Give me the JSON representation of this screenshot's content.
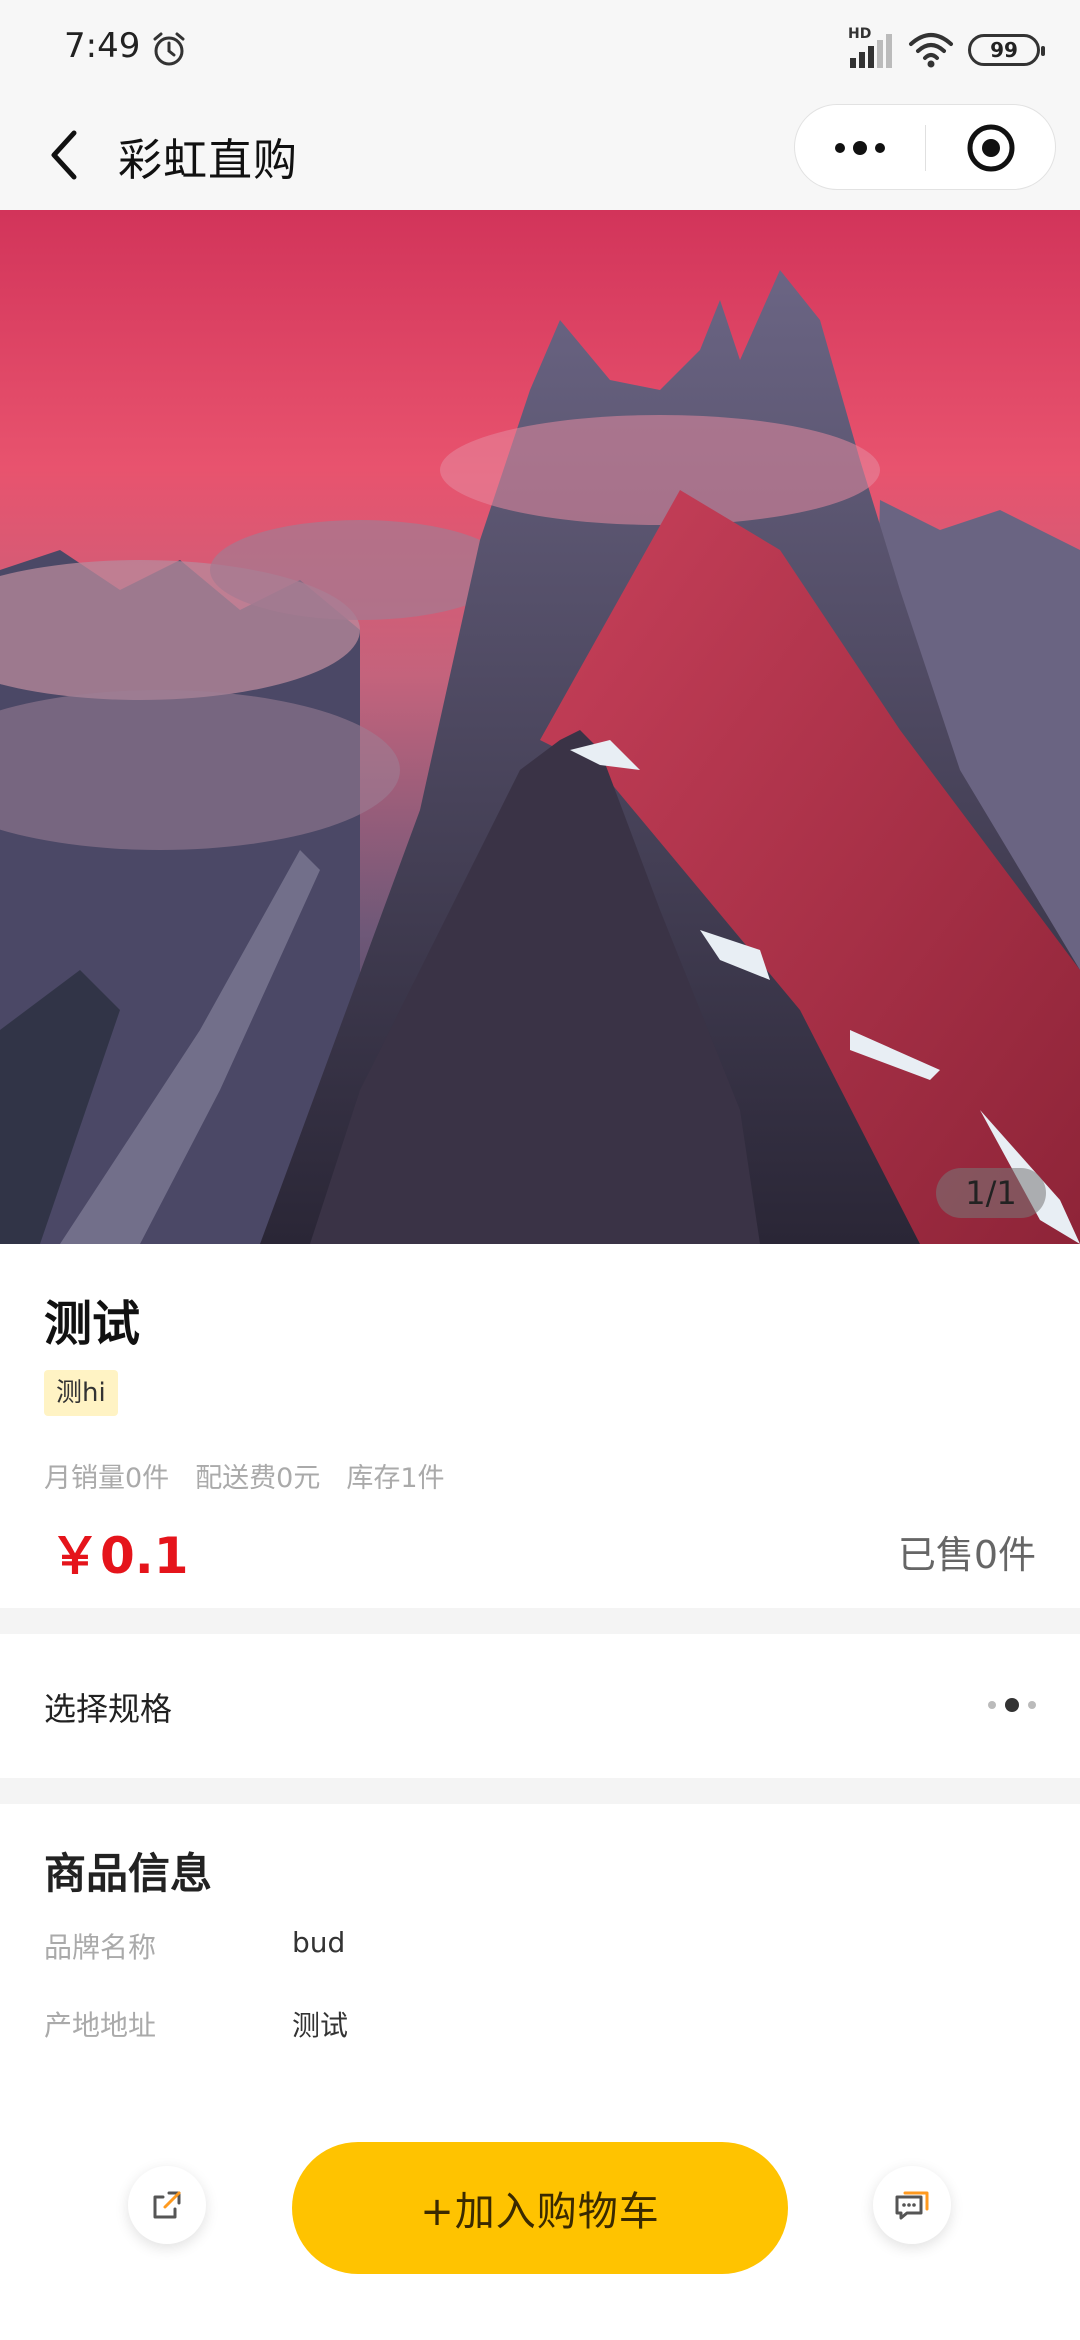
{
  "status_bar": {
    "time": "7:49",
    "battery": "99",
    "network": "HD"
  },
  "nav": {
    "title": "彩虹直购"
  },
  "gallery": {
    "indicator": "1/1"
  },
  "product": {
    "title": "测试",
    "tag": "测hi",
    "monthly_sales": "月销量0件",
    "delivery_fee": "配送费0元",
    "stock": "库存1件",
    "price": "￥0.1",
    "sold": "已售0件"
  },
  "spec": {
    "label": "选择规格"
  },
  "info": {
    "title": "商品信息",
    "rows": [
      {
        "key": "品牌名称",
        "value": "bud"
      },
      {
        "key": "产地地址",
        "value": "测试"
      }
    ]
  },
  "actions": {
    "add_to_cart": "+加入购物车"
  },
  "colors": {
    "accent": "#ffc300",
    "price": "#e5141b",
    "tag_bg": "#fff3c4"
  }
}
